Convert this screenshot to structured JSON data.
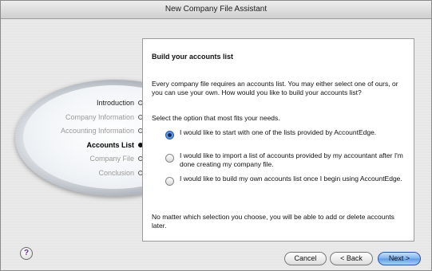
{
  "window": {
    "title": "New Company File Assistant"
  },
  "steps": [
    {
      "label": "Introduction",
      "state": "done"
    },
    {
      "label": "Company Information",
      "state": "pending"
    },
    {
      "label": "Accounting Information",
      "state": "pending"
    },
    {
      "label": "Accounts List",
      "state": "current"
    },
    {
      "label": "Company File",
      "state": "pending"
    },
    {
      "label": "Conclusion",
      "state": "pending"
    }
  ],
  "panel": {
    "heading": "Build your accounts list",
    "intro": "Every company file requires an accounts list.  You may either select one of ours, or you can use your own.  How would you like to build your accounts list?",
    "prompt": "Select the option that most fits your needs.",
    "options": [
      {
        "label": "I would like to start with one of the lists provided by AccountEdge.",
        "selected": true
      },
      {
        "label": "I would like to import a list of accounts provided by my accountant after I'm done creating my company file.",
        "selected": false
      },
      {
        "label": "I would like to build my own accounts list once I begin using AccountEdge.",
        "selected": false
      }
    ],
    "footer_note": "No matter which selection you choose, you will be able to add or delete accounts later."
  },
  "buttons": {
    "help": "?",
    "cancel": "Cancel",
    "back": "< Back",
    "next": "Next >"
  }
}
